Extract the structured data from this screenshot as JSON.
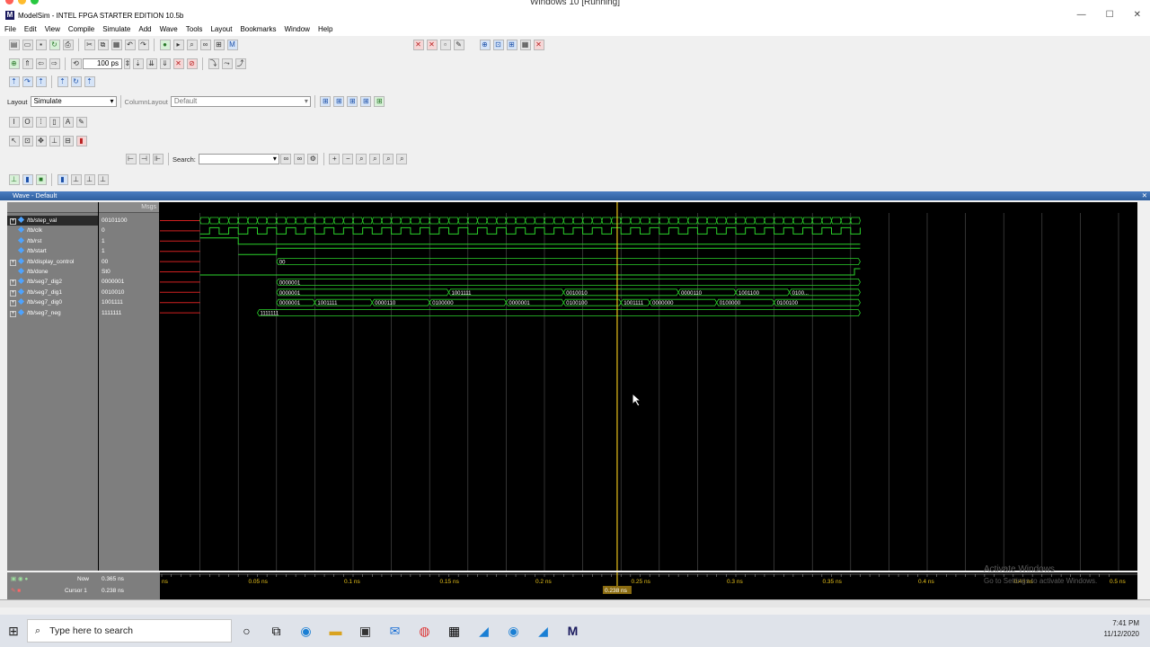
{
  "vm_title": "Windows 10 [Running]",
  "app_title": "ModelSim - INTEL FPGA STARTER EDITION 10.5b",
  "menu": [
    "File",
    "Edit",
    "View",
    "Compile",
    "Simulate",
    "Add",
    "Wave",
    "Tools",
    "Layout",
    "Bookmarks",
    "Window",
    "Help"
  ],
  "toolbar": {
    "run_length": "100 ps",
    "layout_label": "Layout",
    "layout_value": "Simulate",
    "column_layout_label": "ColumnLayout",
    "column_layout_value": "Default",
    "search_label": "Search:"
  },
  "wave_window_title": "Wave - Default",
  "wave": {
    "msgs_header": "Msgs",
    "signals": [
      {
        "name": "/tb/step_val",
        "value": "00101100",
        "expandable": true
      },
      {
        "name": "/tb/clk",
        "value": "0",
        "expandable": false
      },
      {
        "name": "/tb/rst",
        "value": "1",
        "expandable": false
      },
      {
        "name": "/tb/start",
        "value": "1",
        "expandable": false
      },
      {
        "name": "/tb/display_control",
        "value": "00",
        "expandable": true
      },
      {
        "name": "/tb/done",
        "value": "St0",
        "expandable": false
      },
      {
        "name": "/tb/seg7_dig2",
        "value": "0000001",
        "expandable": true
      },
      {
        "name": "/tb/seg7_dig1",
        "value": "0010010",
        "expandable": true
      },
      {
        "name": "/tb/seg7_dig0",
        "value": "1001111",
        "expandable": true
      },
      {
        "name": "/tb/seg7_neg",
        "value": "1111111",
        "expandable": true
      }
    ],
    "bus_labels": {
      "display_control": [
        "00"
      ],
      "seg7_dig2": [
        "0000001"
      ],
      "seg7_dig1": [
        "0000001",
        "1001111",
        "0010010",
        "0000110",
        "1001100",
        "0100..."
      ],
      "seg7_dig0": [
        "0000001",
        "1001111",
        "0000110",
        "0100000",
        "0000001",
        "0100100",
        "1001111",
        "0000000",
        "0100000",
        "0100100"
      ],
      "seg7_neg": [
        "1111111"
      ]
    },
    "now_label": "Now",
    "now_value": "0.365 ns",
    "cursor_label": "Cursor 1",
    "cursor_value": "0.238 ns",
    "cursor_marker": "0.238 ns",
    "time_ticks": [
      "ns",
      "0.05 ns",
      "0.1 ns",
      "0.15 ns",
      "0.2 ns",
      "0.25 ns",
      "0.3 ns",
      "0.35 ns",
      "0.4 ns",
      "0.45 ns",
      "0.5 ns"
    ]
  },
  "watermark": {
    "line1": "Activate Windows",
    "line2": "Go to Settings to activate Windows."
  },
  "taskbar": {
    "search_placeholder": "Type here to search",
    "time": "7:41 PM",
    "date": "11/12/2020"
  },
  "colors": {
    "wave_green": "#2bd32b",
    "cursor": "#e8c21a",
    "red_x": "#d02020"
  }
}
